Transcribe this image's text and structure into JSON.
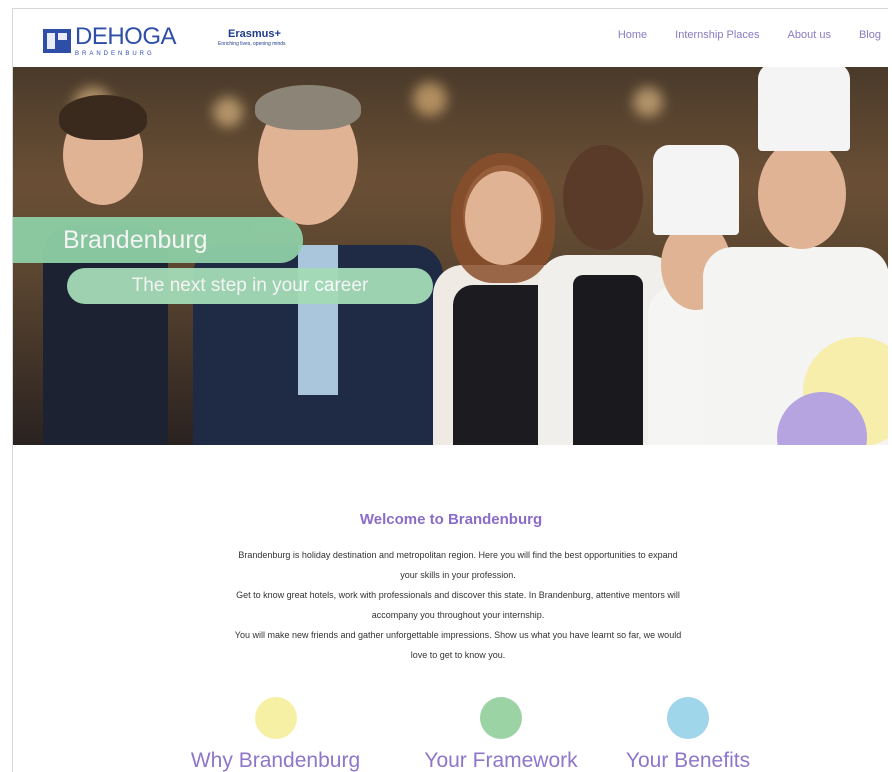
{
  "header": {
    "logo_name": "DEHOGA",
    "logo_sub": "BRANDENBURG",
    "erasmus_name": "Erasmus+",
    "erasmus_sub": "Enriching lives, opening minds"
  },
  "nav": {
    "items": [
      "Home",
      "Internship Places",
      "About us",
      "Blog"
    ]
  },
  "hero": {
    "title": "Brandenburg",
    "subtitle": "The next step in your career"
  },
  "welcome": {
    "heading": "Welcome to Brandenburg",
    "lines": [
      "Brandenburg is holiday destination and metropolitan region. Here you will find the best opportunities to expand",
      "your skills in your profession.",
      "Get to know great hotels, work with professionals and discover this state. In Brandenburg, attentive mentors will",
      "accompany you throughout your internship.",
      "You will make new friends and gather unforgettable impressions. Show us what you have learnt so far, we would",
      "love to get to know you."
    ]
  },
  "features": [
    {
      "label": "Why Brandenburg",
      "color": "#f6f0a4"
    },
    {
      "label": "Your Framework",
      "color": "#9cd3a5"
    },
    {
      "label": "Your Benefits",
      "color": "#9fd6ea"
    }
  ],
  "colors": {
    "accent_purple": "#8a6cc9",
    "hero_green": "#8ecfa6",
    "brand_blue": "#2f4ea8"
  }
}
